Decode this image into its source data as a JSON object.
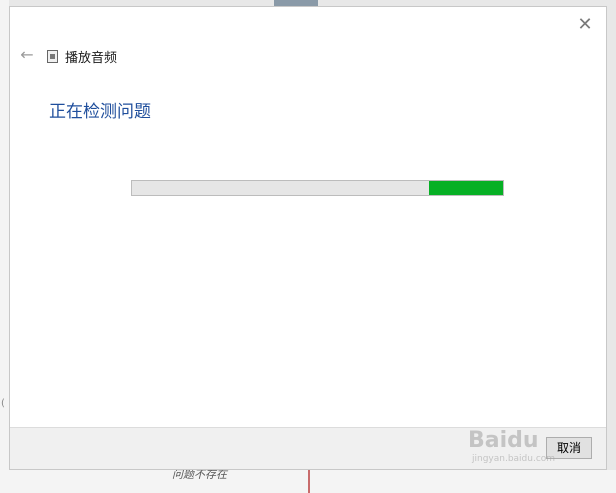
{
  "dialog": {
    "title": "播放音频",
    "heading": "正在检测问题",
    "close_glyph": "✕",
    "back_glyph": "←",
    "progress": {
      "indeterminate": true,
      "segment_start": 0.8,
      "segment_end": 1.0,
      "fill_color": "#06b025"
    },
    "cancel_label": "取消"
  },
  "background": {
    "bottom_text": "问题不存在"
  },
  "watermark": {
    "text": "Baidu",
    "sub": "jingyan.baidu.com"
  },
  "icons": {
    "close": "close-icon",
    "back": "back-arrow-icon",
    "app": "troubleshooter-icon"
  }
}
